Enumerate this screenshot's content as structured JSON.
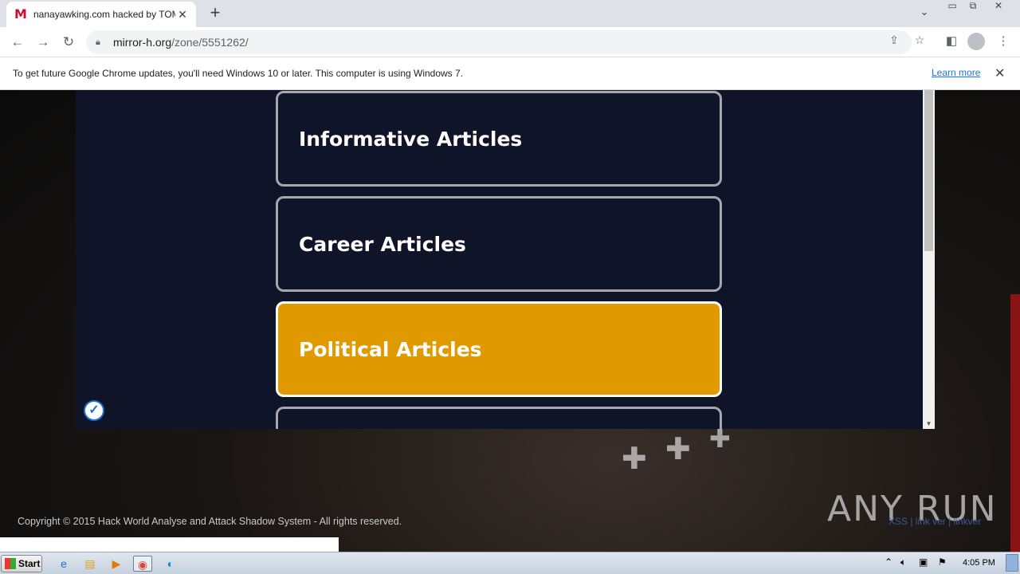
{
  "browser": {
    "tab": {
      "favicon": "M",
      "title": "nanayawking.com hacked by TOMO",
      "close": "✕"
    },
    "new_tab": "+",
    "window_controls": [
      "▭",
      "⧉",
      "✕"
    ],
    "url": {
      "host": "mirror-h.org",
      "path": "/zone/5551262/"
    },
    "infobar": {
      "message": "To get future Google Chrome updates, you'll need Windows 10 or later. This computer is using Windows 7.",
      "learn_more": "Learn more",
      "close": "✕"
    }
  },
  "page": {
    "cards": [
      {
        "label": "Informative Articles",
        "active": false
      },
      {
        "label": "Career Articles",
        "active": false
      },
      {
        "label": "Political Articles",
        "active": true
      }
    ],
    "footer": {
      "copyright": "Copyright © 2015 Hack World Analyse and Attack Shadow System - All rights reserved.",
      "links": "XSS | link ver | linkver"
    },
    "watermark": "ANY RUN"
  },
  "taskbar": {
    "start": "Start",
    "clock": "4:05 PM"
  },
  "colors": {
    "modal_bg": "#0f1428",
    "active_card": "#e09a00",
    "card_border": "#a6a6ad"
  }
}
